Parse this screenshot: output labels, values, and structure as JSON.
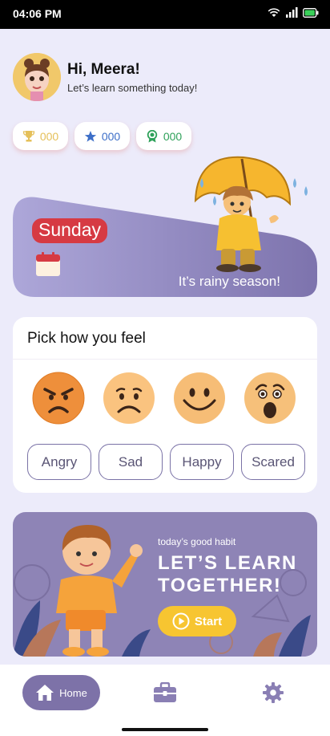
{
  "status_bar": {
    "time": "04:06 PM",
    "icons": [
      "wifi-icon",
      "signal-icon",
      "battery-icon"
    ]
  },
  "user": {
    "greeting": "Hi, Meera!",
    "subtitle": "Let’s learn something today!"
  },
  "stats": [
    {
      "icon": "trophy-icon",
      "value": "000",
      "color": "#e5c05a"
    },
    {
      "icon": "star-icon",
      "value": "000",
      "color": "#3d6fc8"
    },
    {
      "icon": "medal-icon",
      "value": "000",
      "color": "#2fa15a"
    }
  ],
  "weather_card": {
    "day": "Sunday",
    "message": "It’s rainy season!"
  },
  "feelings": {
    "title": "Pick how you feel",
    "options": [
      {
        "label": "Angry",
        "icon": "angry-face-icon"
      },
      {
        "label": "Sad",
        "icon": "sad-face-icon"
      },
      {
        "label": "Happy",
        "icon": "happy-face-icon"
      },
      {
        "label": "Scared",
        "icon": "scared-face-icon"
      }
    ]
  },
  "habit_card": {
    "label": "today’s good habit",
    "title": "LET’S LEARN TOGETHER!",
    "button": "Start"
  },
  "nav": {
    "items": [
      {
        "label": "Home",
        "icon": "home-icon",
        "active": true
      },
      {
        "icon": "briefcase-icon"
      },
      {
        "icon": "gear-icon"
      }
    ]
  },
  "colors": {
    "background": "#ecebfa",
    "accent": "#7d72a8",
    "day_badge": "#d63a43",
    "start_button": "#f7c531"
  }
}
